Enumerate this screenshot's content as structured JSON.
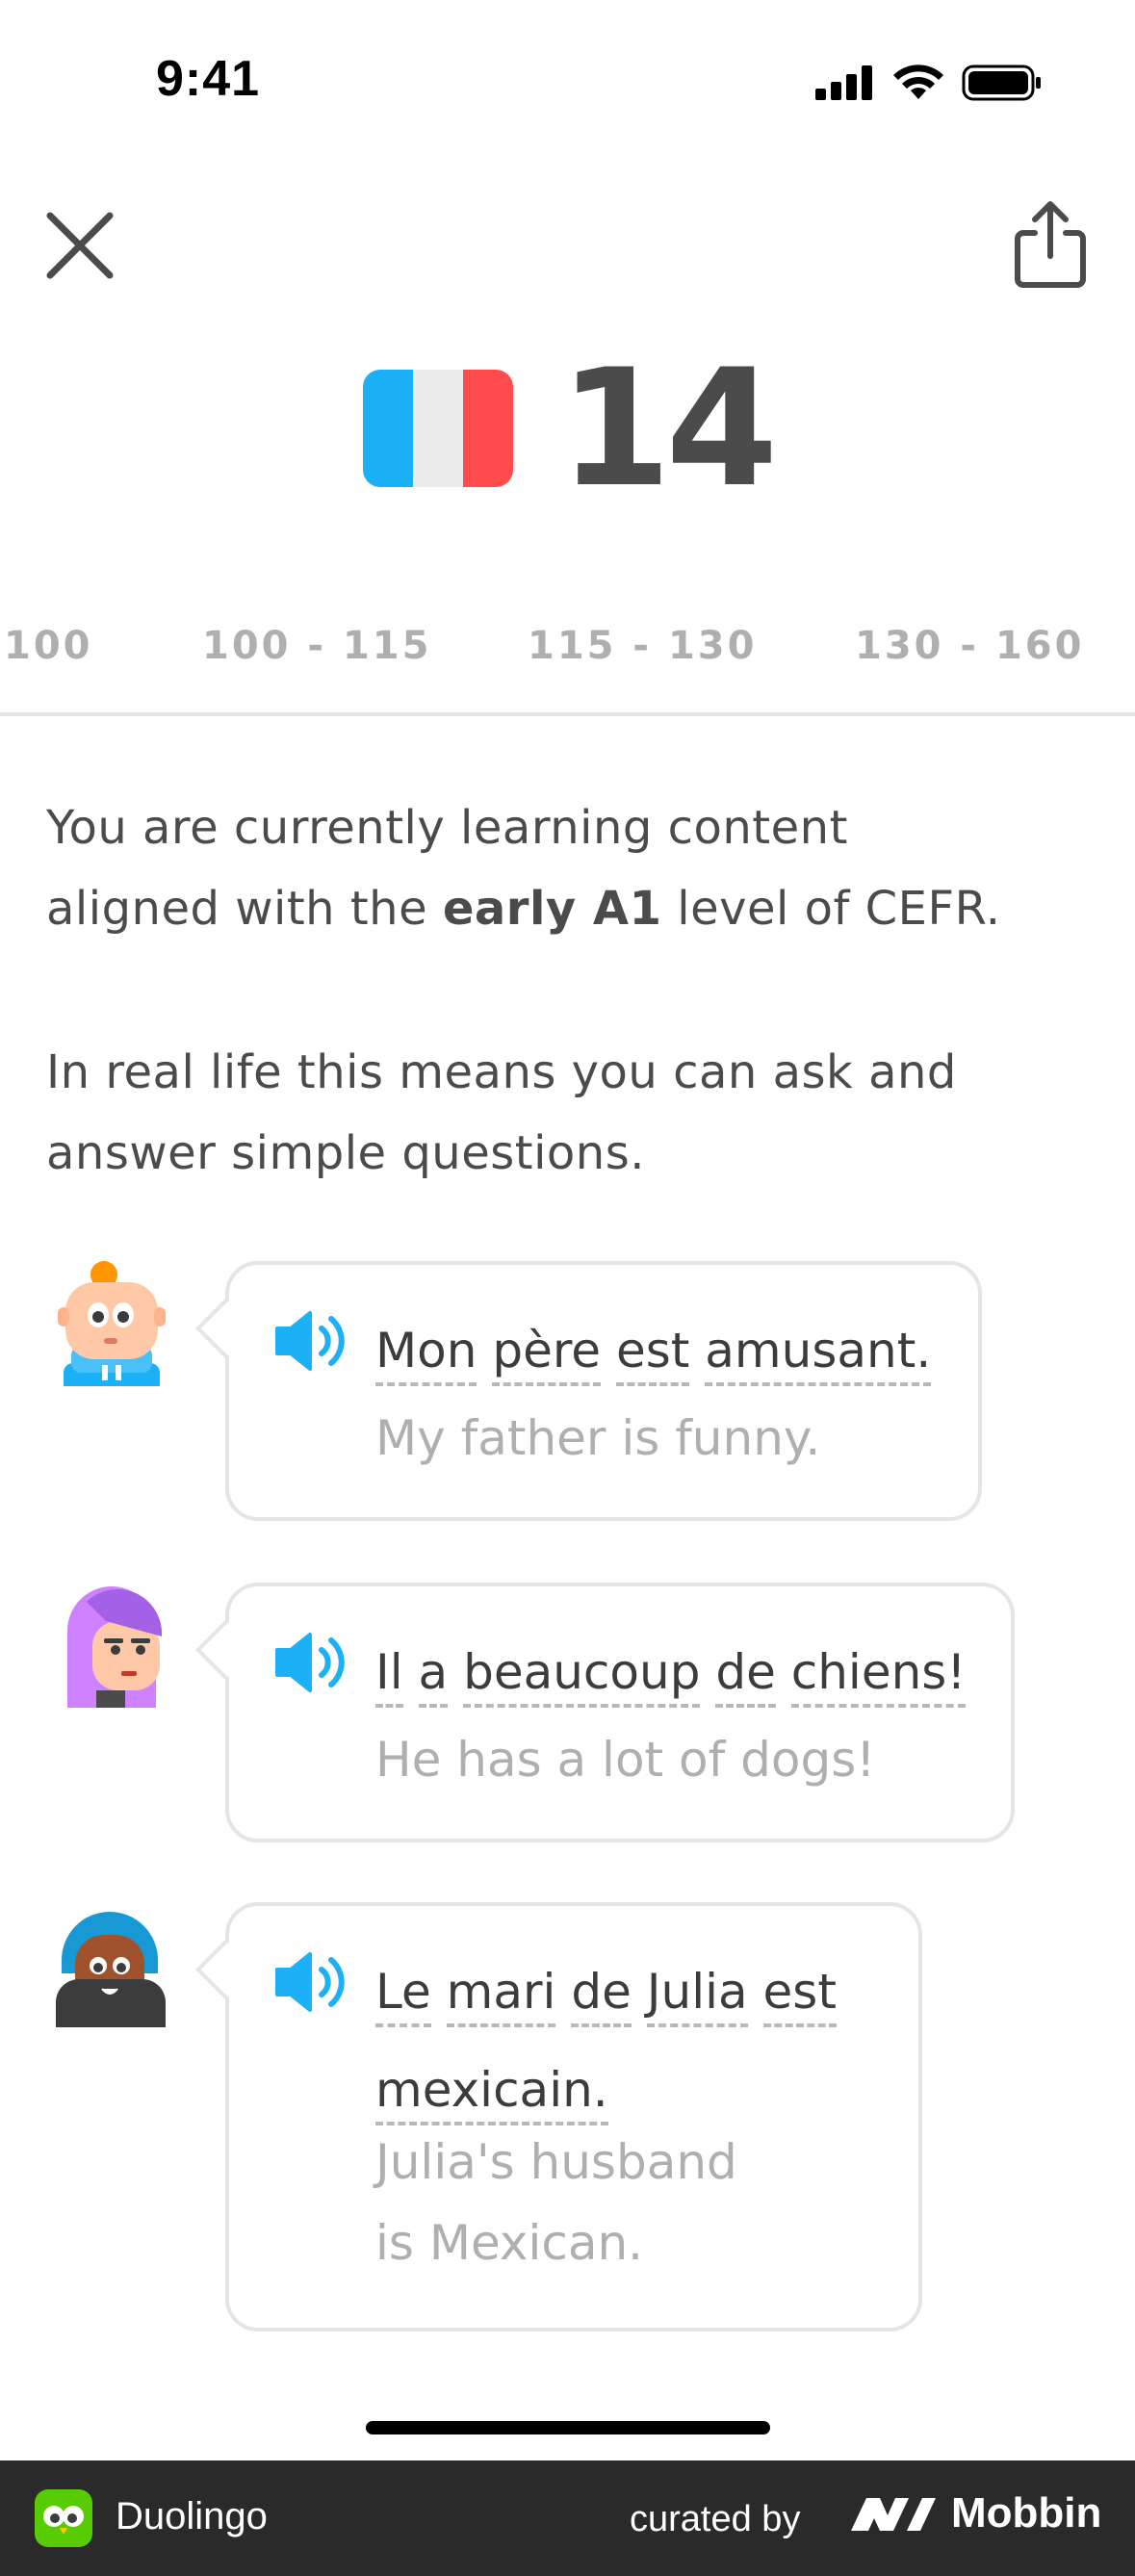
{
  "status_bar": {
    "time": "9:41"
  },
  "header": {
    "close_icon": "close-icon",
    "share_icon": "share-icon"
  },
  "score": {
    "flag_icon": "france-flag-icon",
    "value": "14",
    "flag_colors": [
      "#1cb0f6",
      "#f0f0f0",
      "#ff4b4b"
    ]
  },
  "score_ranges": [
    "100",
    "100 - 115",
    "115 - 130",
    "130 - 160"
  ],
  "description": {
    "line1": "You are currently learning content",
    "line2_prefix": "aligned with the ",
    "line2_bold": "early A1",
    "line2_suffix": " level of CEFR."
  },
  "real_life": {
    "line1": "In real life this means you can ask and",
    "line2": "answer simple questions."
  },
  "examples": [
    {
      "avatar": "child-avatar-icon",
      "phrase_words": [
        "Mon",
        "père",
        "est",
        "amusant."
      ],
      "translation": "My father is funny."
    },
    {
      "avatar": "purple-hair-woman-avatar-icon",
      "phrase_words": [
        "Il",
        "a",
        "beaucoup",
        "de",
        "chiens!"
      ],
      "translation": "He has a lot of dogs!"
    },
    {
      "avatar": "bearded-man-avatar-icon",
      "phrase_words": [
        "Le",
        "mari",
        "de",
        "Julia",
        "est",
        "mexicain."
      ],
      "translation_line1": "Julia's husband",
      "translation_line2": "is Mexican."
    }
  ],
  "footer": {
    "app_name": "Duolingo",
    "curated_by": "curated by",
    "brand": "Mobbin"
  },
  "colors": {
    "accent_blue": "#1cb0f6",
    "text": "#4b4b4b",
    "muted": "#afafaf",
    "border": "#e5e5e5",
    "footer_bg": "#2a2a2a"
  }
}
